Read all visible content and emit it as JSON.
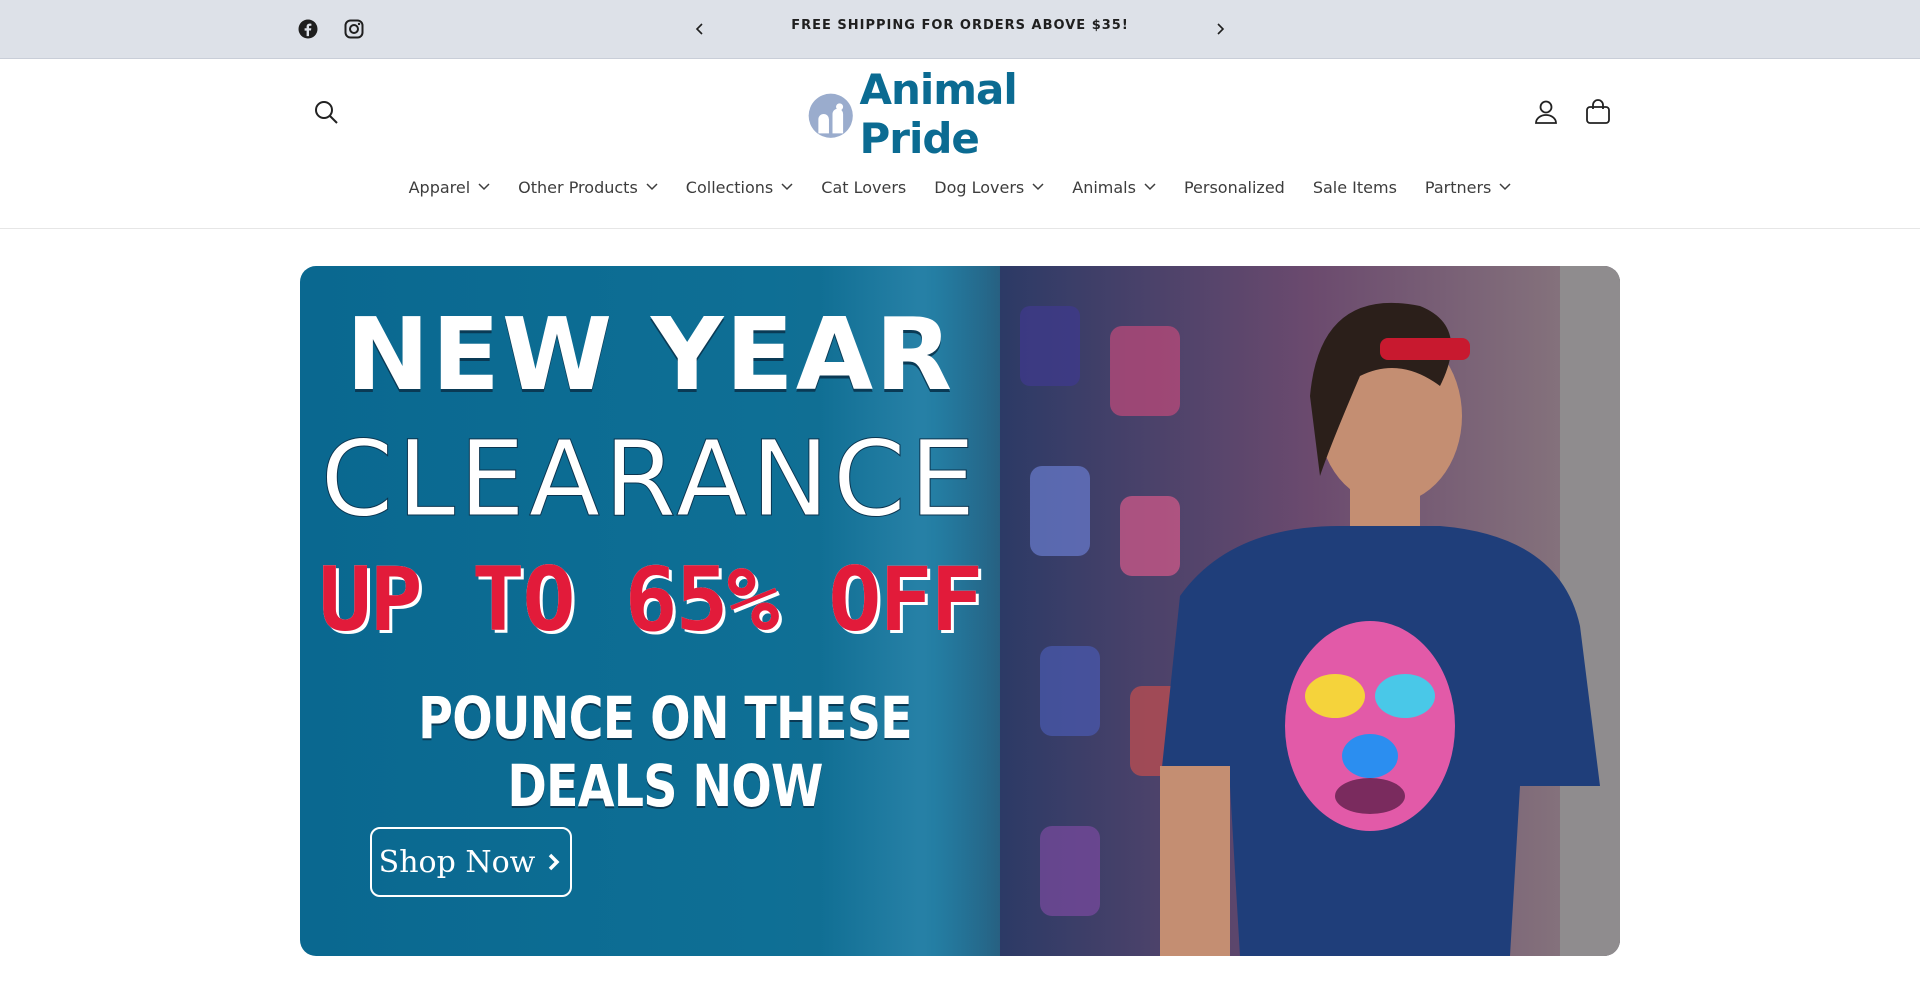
{
  "announcement": {
    "text": "FREE SHIPPING FOR ORDERS ABOVE $35!",
    "social": [
      "facebook-icon",
      "instagram-icon"
    ]
  },
  "header": {
    "logo_text": "Animal Pride",
    "icons": [
      "search-icon",
      "account-icon",
      "cart-icon"
    ],
    "brand_color": "#0b6b92"
  },
  "nav": {
    "items": [
      {
        "label": "Apparel",
        "has_dropdown": true
      },
      {
        "label": "Other Products",
        "has_dropdown": true
      },
      {
        "label": "Collections",
        "has_dropdown": true
      },
      {
        "label": "Cat Lovers",
        "has_dropdown": false
      },
      {
        "label": "Dog Lovers",
        "has_dropdown": true
      },
      {
        "label": "Animals",
        "has_dropdown": true
      },
      {
        "label": "Personalized",
        "has_dropdown": false
      },
      {
        "label": "Sale Items",
        "has_dropdown": false
      },
      {
        "label": "Partners",
        "has_dropdown": true
      }
    ]
  },
  "hero": {
    "line1": "NEW YEAR",
    "line2": "CLEARANCE",
    "line3": "UP TO 65% OFF",
    "line4": "POUNCE ON THESE DEALS NOW",
    "button_label": "Shop Now",
    "accent_red": "#e21b3a",
    "background_blue": "#0a6890"
  }
}
